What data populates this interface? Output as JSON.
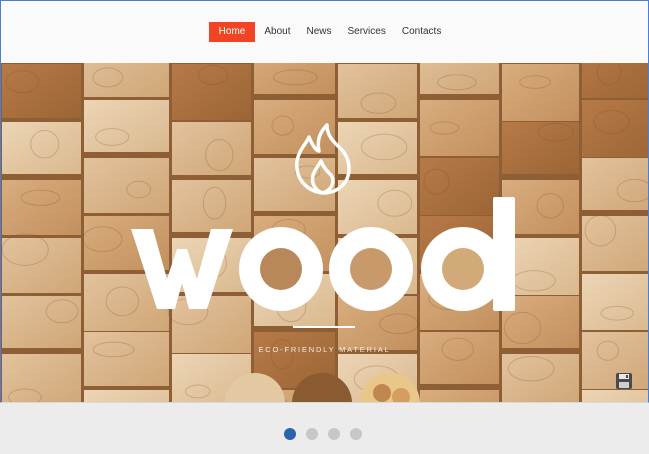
{
  "nav": {
    "items": [
      {
        "label": "Home",
        "active": true
      },
      {
        "label": "About",
        "active": false
      },
      {
        "label": "News",
        "active": false
      },
      {
        "label": "Services",
        "active": false
      },
      {
        "label": "Contacts",
        "active": false
      }
    ]
  },
  "hero": {
    "logo_text": "wood",
    "tagline": "ECO-FRIENDLY MATERIAL",
    "flame_icon": "flame-icon",
    "save_icon": "floppy-disk-icon"
  },
  "slider": {
    "slide_count": 4,
    "active_index": 0
  },
  "colors": {
    "accent": "#f04424",
    "active_dot": "#2e61b0",
    "inactive_dot": "#c7c7c7"
  }
}
